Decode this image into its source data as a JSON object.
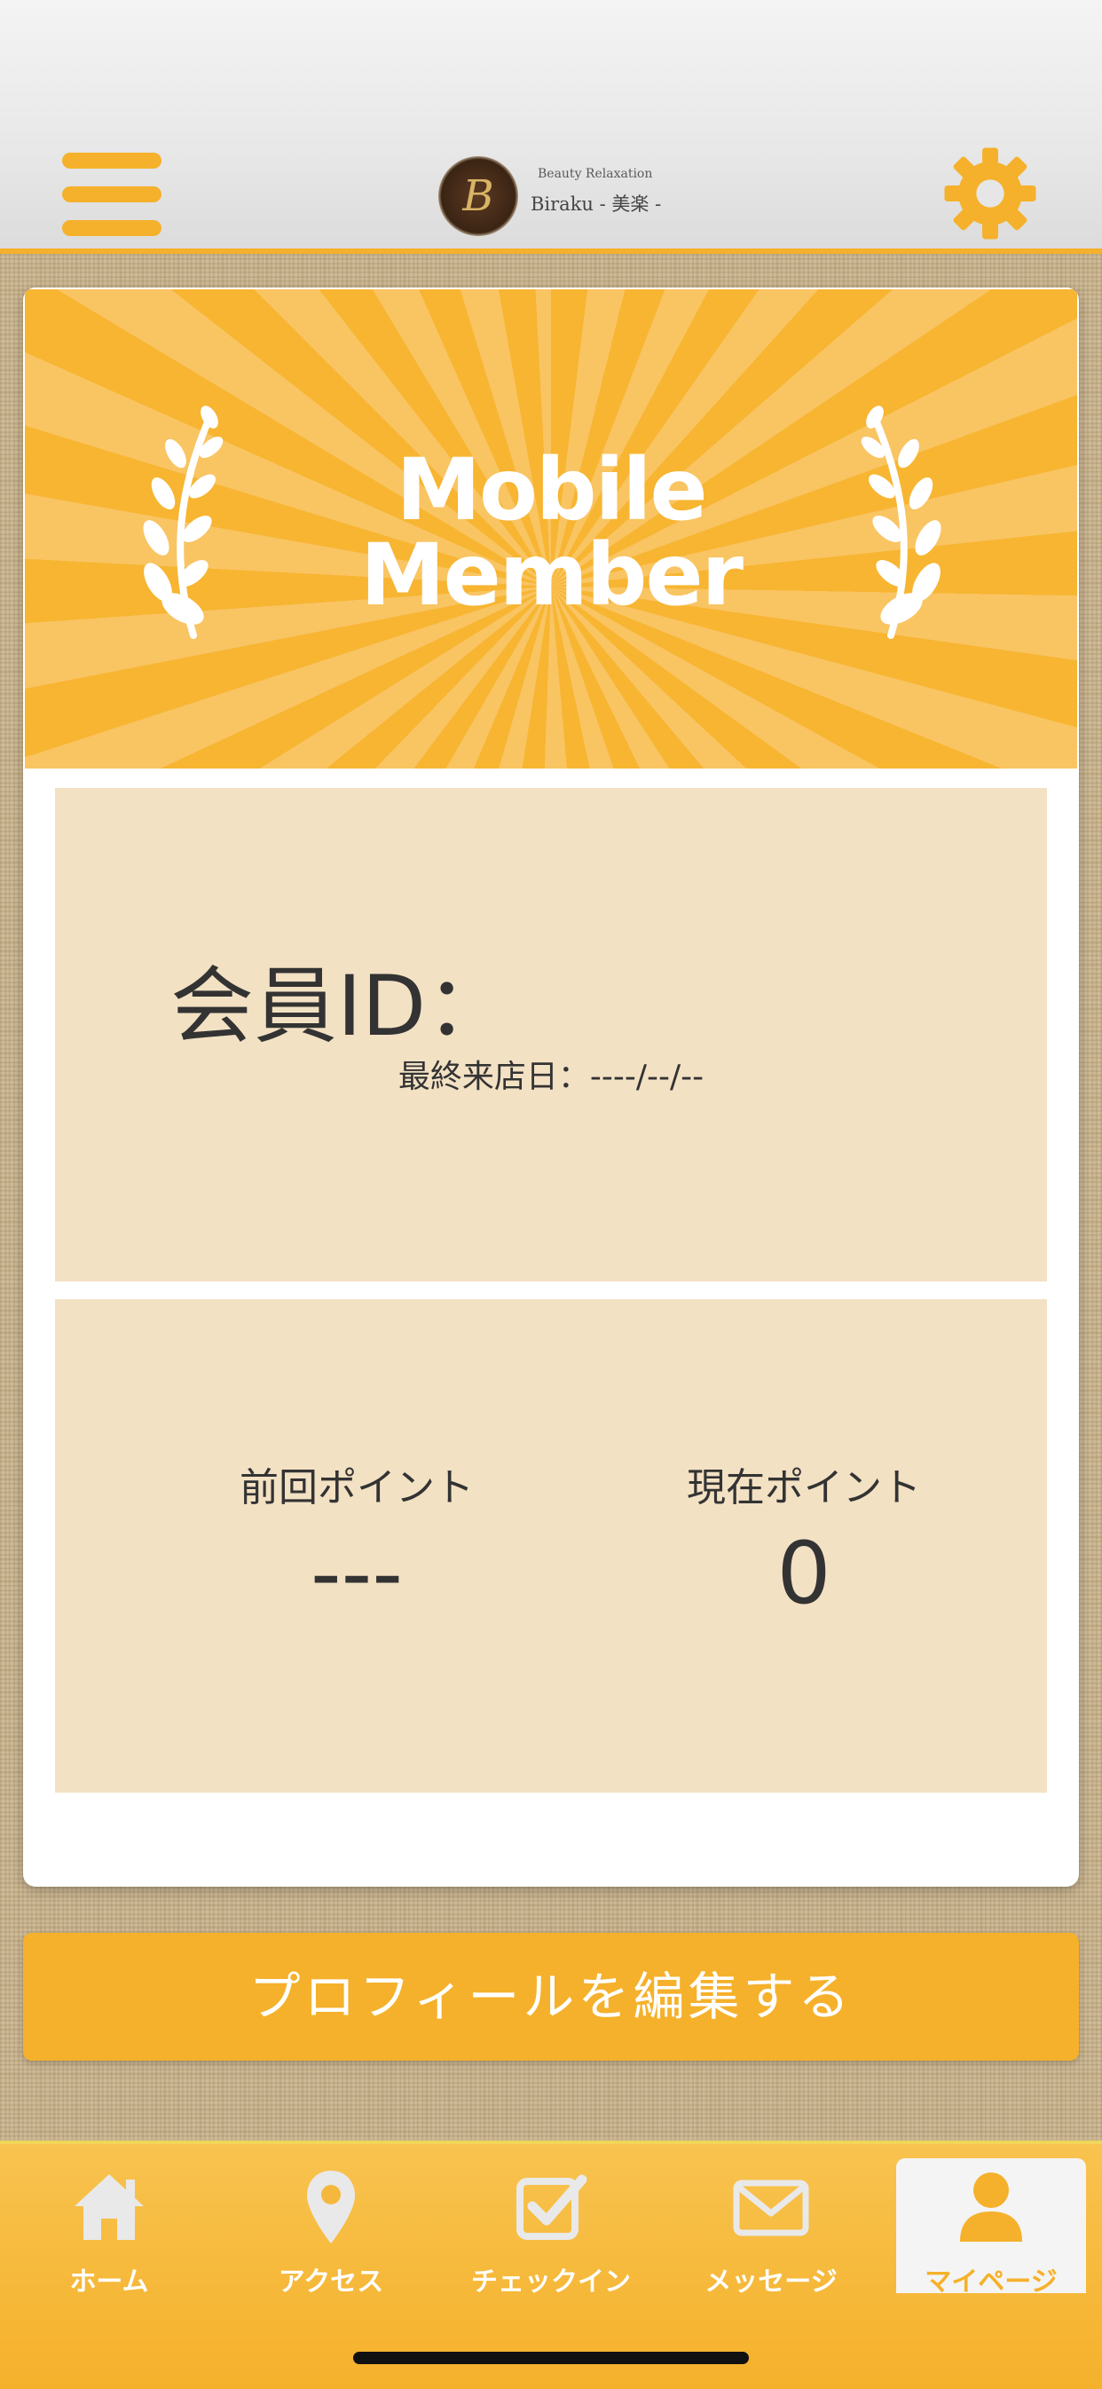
{
  "header": {
    "logo_mark": "B",
    "logo_subtitle": "Beauty Relaxation",
    "logo_name": "Biraku - 美楽 -"
  },
  "banner": {
    "title_line1": "Mobile",
    "title_line2": "Member"
  },
  "member": {
    "id_label": "会員ID：",
    "last_visit": "最終来店日：----/--/--"
  },
  "points": {
    "previous_label": "前回ポイント",
    "previous_value": "---",
    "current_label": "現在ポイント",
    "current_value": "0"
  },
  "edit_button_label": "プロフィールを編集する",
  "tabs": [
    {
      "label": "ホーム",
      "icon": "home-icon"
    },
    {
      "label": "アクセス",
      "icon": "map-pin-icon"
    },
    {
      "label": "チェックイン",
      "icon": "checkbox-icon"
    },
    {
      "label": "メッセージ",
      "icon": "envelope-icon"
    },
    {
      "label": "マイページ",
      "icon": "user-icon",
      "active": true
    }
  ],
  "colors": {
    "accent": "#f5b12b",
    "panel": "#f3e1c4",
    "text": "#333333"
  }
}
